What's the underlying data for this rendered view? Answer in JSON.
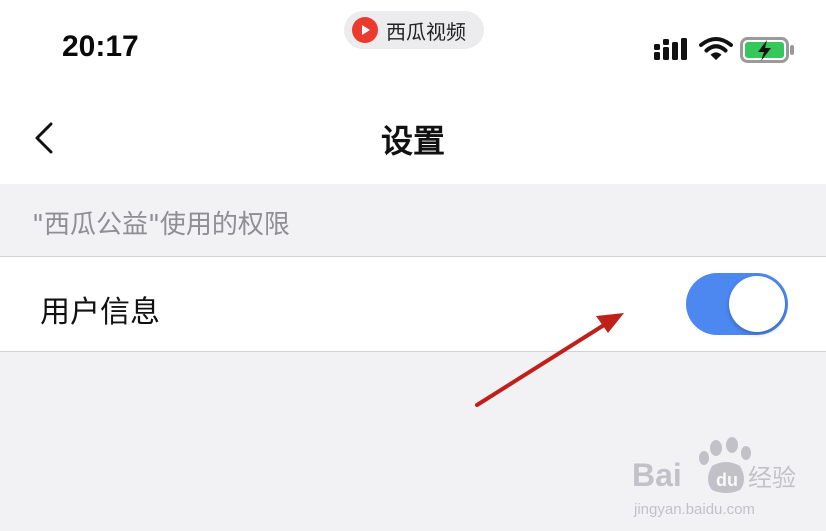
{
  "status_bar": {
    "time": "20:17",
    "app_name": "西瓜视频"
  },
  "nav": {
    "title": "设置"
  },
  "section": {
    "header": "\"西瓜公益\"使用的权限"
  },
  "rows": [
    {
      "label": "用户信息",
      "toggle_on": true
    }
  ],
  "colors": {
    "toggle_on": "#4c88f0",
    "annotation_arrow": "#c0201a",
    "app_logo": "#ea3b2e"
  }
}
